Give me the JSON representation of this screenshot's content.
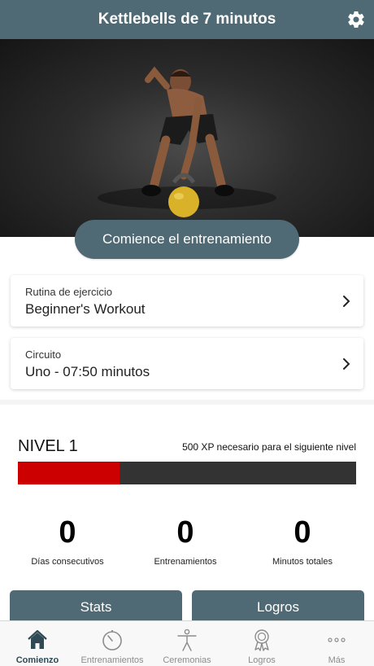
{
  "header": {
    "title": "Kettlebells de 7 minutos",
    "settings_icon": "gear-icon"
  },
  "hero": {
    "description": "man with kettlebell"
  },
  "start_button": "Comience el entrenamiento",
  "cards": [
    {
      "label": "Rutina de ejercicio",
      "value": "Beginner's Workout"
    },
    {
      "label": "Circuito",
      "value": "Uno - 07:50 minutos"
    }
  ],
  "level": {
    "title": "NIVEL 1",
    "xp_text": "500 XP necesario para el siguiente nivel",
    "progress_fraction": 0.3,
    "fill_color": "#cc0000",
    "track_color": "#333333"
  },
  "stats": [
    {
      "value": "0",
      "label": "Días consecutivos"
    },
    {
      "value": "0",
      "label": "Entrenamientos"
    },
    {
      "value": "0",
      "label": "Minutos totales"
    }
  ],
  "buttons": {
    "stats": "Stats",
    "achievements": "Logros"
  },
  "tabs": [
    {
      "label": "Comienzo",
      "icon": "home-icon",
      "active": true
    },
    {
      "label": "Entrenamientos",
      "icon": "stopwatch-icon",
      "active": false
    },
    {
      "label": "Ceremonias",
      "icon": "person-icon",
      "active": false
    },
    {
      "label": "Logros",
      "icon": "award-icon",
      "active": false
    },
    {
      "label": "Más",
      "icon": "more-icon",
      "active": false
    }
  ],
  "colors": {
    "primary": "#4f6a74",
    "active_tab": "#2f4a55",
    "inactive_tab": "#8c8c8c"
  }
}
